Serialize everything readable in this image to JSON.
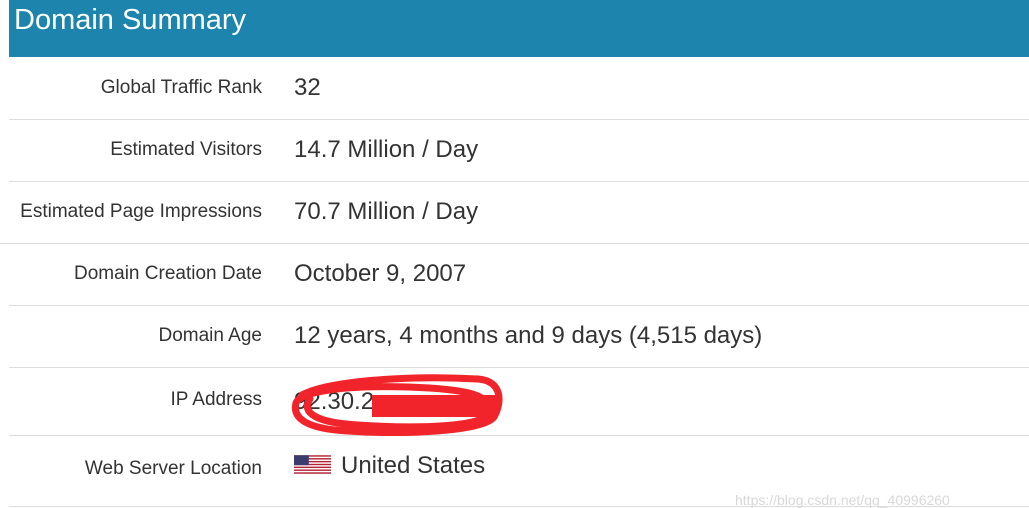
{
  "header": {
    "title": "Domain Summary",
    "color": "#1c84ad"
  },
  "rows": [
    {
      "label": "Global Traffic Rank",
      "value": "32"
    },
    {
      "label": "Estimated Visitors",
      "value": "14.7 Million / Day"
    },
    {
      "label": "Estimated Page Impressions",
      "value": "70.7 Million / Day"
    },
    {
      "label": "Domain Creation Date",
      "value": "October 9, 2007"
    },
    {
      "label": "Domain Age",
      "value": "12 years, 4 months and 9 days (4,515 days)"
    },
    {
      "label": "IP Address",
      "value": "92.30.2"
    },
    {
      "label": "Web Server Location",
      "value": "United States",
      "icon": "us-flag-icon"
    }
  ],
  "redaction": {
    "color": "#f2242b",
    "icon": "red-scribble-redaction"
  },
  "watermark": {
    "text": "https://blog.csdn.net/qq_40996260"
  }
}
